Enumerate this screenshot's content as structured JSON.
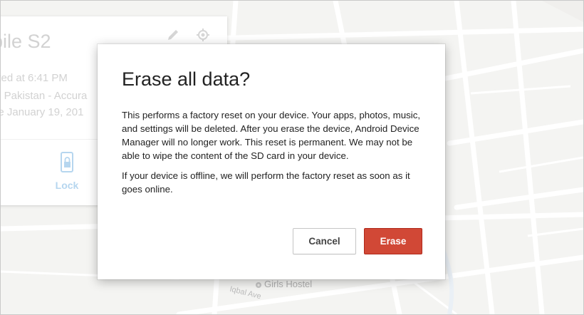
{
  "device_card": {
    "name": "bile S2",
    "located": "ated at 6:41 PM",
    "location": "e, Pakistan - Accura",
    "online": "ne January 19, 201",
    "edit_icon": "pencil-icon",
    "locate_icon": "crosshair-icon",
    "lock_icon": "phone-lock-icon",
    "lock_label": "Lock"
  },
  "map": {
    "poi_label": "Girls Hostel",
    "street_label": "Iqbal Ave",
    "pin_icon": "map-pin-icon"
  },
  "dialog": {
    "title": "Erase all data?",
    "paragraphs": [
      "This performs a factory reset on your device. Your apps, photos, music, and settings will be deleted. After you erase the device, Android Device Manager will no longer work. This reset is permanent. We may not be able to wipe the content of the SD card in your device.",
      "If your device is offline, we will perform the factory reset as soon as it goes online."
    ],
    "cancel_label": "Cancel",
    "erase_label": "Erase"
  },
  "colors": {
    "erase_button": "#d14836",
    "lock_accent": "#b6d6ef",
    "map_background": "#ecebe8"
  }
}
